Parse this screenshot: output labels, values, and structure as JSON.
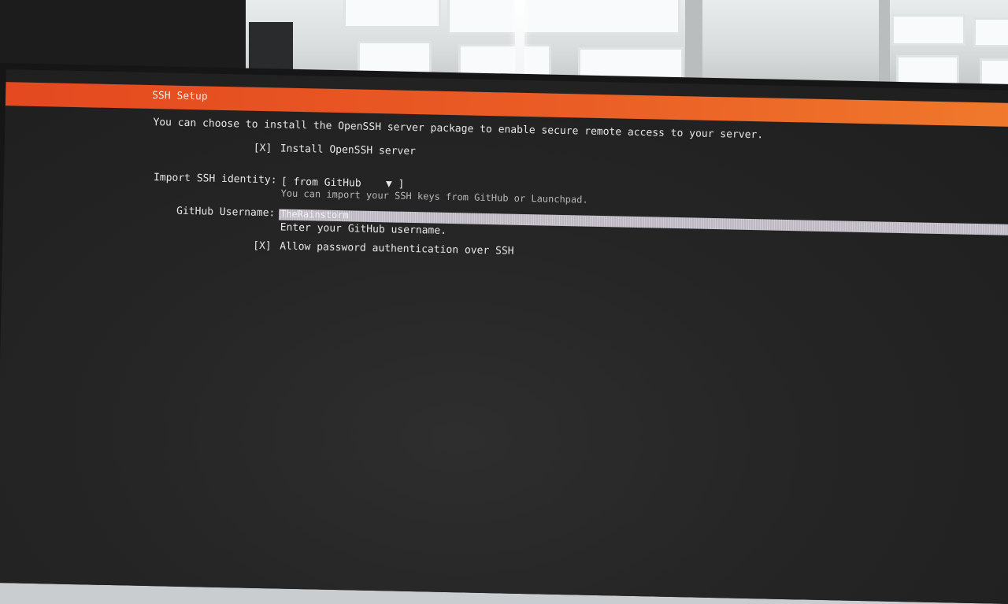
{
  "header": {
    "title": "SSH Setup"
  },
  "intro": "You can choose to install the OpenSSH server package to enable secure remote access to your server.",
  "install_openssh": {
    "mark": "[X]",
    "label": "Install OpenSSH server"
  },
  "import_identity": {
    "label": "Import SSH identity:",
    "value": "[ from GitHub    ▼ ]",
    "help": "You can import your SSH keys from GitHub or Launchpad."
  },
  "github_username": {
    "label": "GitHub Username:",
    "value": "TheRainstorm",
    "help": "Enter your GitHub username."
  },
  "allow_password": {
    "mark": "[X]",
    "label": "Allow password authentication over SSH"
  },
  "colors": {
    "header_bar": "#E95420",
    "screen_bg": "#252525",
    "text": "#E6E6E6"
  }
}
